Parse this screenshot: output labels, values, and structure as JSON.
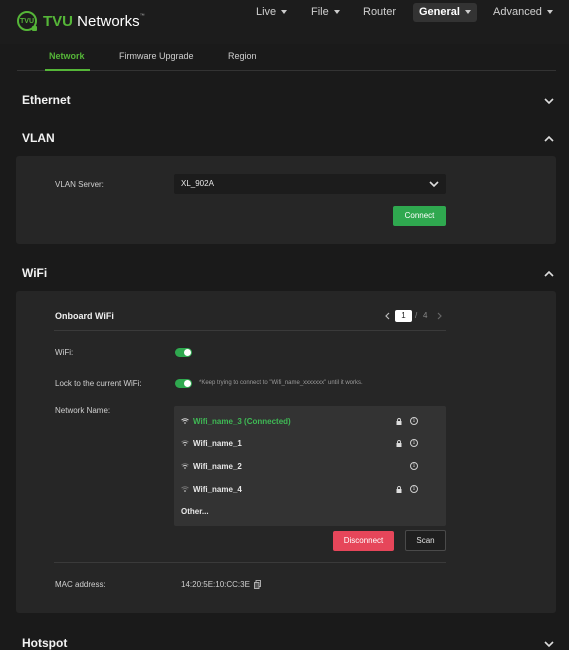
{
  "app": {
    "brand_bold": "TVU",
    "brand_rest": " Networks",
    "logo_badge": "TVU",
    "accent": "#55b638"
  },
  "nav": {
    "items": [
      {
        "label": "Live",
        "has_caret": true,
        "active": false
      },
      {
        "label": "File",
        "has_caret": true,
        "active": false
      },
      {
        "label": "Router",
        "has_caret": false,
        "active": false
      },
      {
        "label": "General",
        "has_caret": true,
        "active": true
      },
      {
        "label": "Advanced",
        "has_caret": true,
        "active": false
      }
    ]
  },
  "subtabs": [
    {
      "label": "Network",
      "active": true
    },
    {
      "label": "Firmware Upgrade",
      "active": false
    },
    {
      "label": "Region",
      "active": false
    }
  ],
  "sections": {
    "ethernet": {
      "title": "Ethernet",
      "expanded": false
    },
    "vlan": {
      "title": "VLAN",
      "expanded": true,
      "server_label": "VLAN Server:",
      "server_value": "XL_902A",
      "connect_label": "Connect"
    },
    "wifi": {
      "title": "WiFi",
      "expanded": true,
      "card_title": "Onboard WiFi",
      "pager": {
        "current": "1",
        "separator": "/",
        "total": "4"
      },
      "wifi_label": "WiFi:",
      "wifi_enabled": true,
      "lock_label": "Lock to the current WiFi:",
      "lock_enabled": true,
      "lock_hint": "*Keep trying to connect to \"Wifi_name_xxxxxxx\" until it works.",
      "network_name_label": "Network Name:",
      "networks": [
        {
          "name": "Wifi_name_3 (Connected)",
          "connected": true,
          "locked": true,
          "signal": "full"
        },
        {
          "name": "Wifi_name_1",
          "connected": false,
          "locked": true,
          "signal": "medium"
        },
        {
          "name": "Wifi_name_2",
          "connected": false,
          "locked": false,
          "signal": "medium"
        },
        {
          "name": "Wifi_name_4",
          "connected": false,
          "locked": true,
          "signal": "low"
        }
      ],
      "other_label": "Other...",
      "disconnect_label": "Disconnect",
      "scan_label": "Scan",
      "mac_label": "MAC address:",
      "mac_value": "14:20:5E:10:CC:3E"
    },
    "hotspot": {
      "title": "Hotspot",
      "expanded": false
    }
  },
  "colors": {
    "green": "#2fa84f",
    "red": "#e6465a",
    "connected_text": "#3fb955"
  }
}
